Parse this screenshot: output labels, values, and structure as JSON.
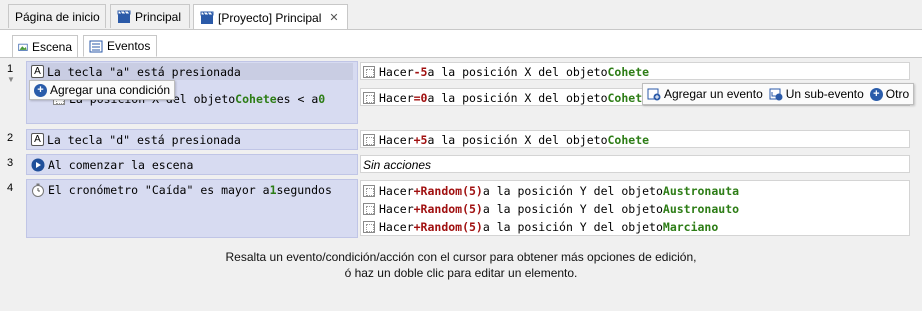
{
  "tabs": [
    {
      "label": "Página de inicio"
    },
    {
      "label": "Principal"
    },
    {
      "label": "[Proyecto] Principal",
      "close": "✕"
    }
  ],
  "subtabs": [
    {
      "label": "Escena"
    },
    {
      "label": "Eventos"
    }
  ],
  "events": [
    {
      "number": "1",
      "conditions": [
        {
          "pre": "La tecla \"a\" está presionada"
        },
        {
          "pre": "La posición X del objeto ",
          "obj": "Cohete",
          "mid": " es < a ",
          "val": "0"
        }
      ],
      "actions": [
        {
          "pre": "Hacer ",
          "op": "-5",
          "mid": " a la posición X del objeto ",
          "obj": "Cohete"
        },
        {
          "pre": "Hacer ",
          "op": "=0",
          "mid": " a la posición X del objeto ",
          "obj": "Cohete"
        }
      ]
    },
    {
      "number": "2",
      "conditions": [
        {
          "pre": "La tecla \"d\" está presionada"
        }
      ],
      "actions": [
        {
          "pre": "Hacer ",
          "op": "+5",
          "mid": " a la posición X del objeto ",
          "obj": "Cohete"
        }
      ]
    },
    {
      "number": "3",
      "conditions": [
        {
          "pre": "Al comenzar la escena"
        }
      ],
      "no_actions": "Sin acciones"
    },
    {
      "number": "4",
      "conditions": [
        {
          "pre": "El cronómetro \"Caída\" es mayor a ",
          "val": "1",
          "post": " segundos"
        }
      ],
      "actions": [
        {
          "pre": "Hacer ",
          "op": "+Random(5)",
          "mid": " a la posición Y del objeto ",
          "obj": "Austronauta"
        },
        {
          "pre": "Hacer ",
          "op": "+Random(5)",
          "mid": " a la posición Y del objeto ",
          "obj": "Austronauto"
        },
        {
          "pre": "Hacer ",
          "op": "+Random(5)",
          "mid": " a la posición Y del objeto ",
          "obj": "Marciano"
        }
      ]
    }
  ],
  "popup_condition": "Agregar una condición",
  "popup_actions": {
    "add_event": "Agregar un evento",
    "sub_event": "Un sub-evento",
    "other": "Otro"
  },
  "hint": {
    "line1": "Resalta un evento/condición/acción con el cursor para obtener más opciones de edición,",
    "line2": "ó haz un doble clic para editar un elemento."
  },
  "key_icon_letter": "A"
}
